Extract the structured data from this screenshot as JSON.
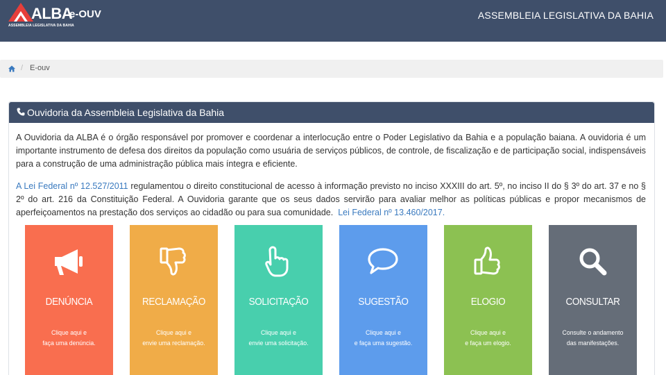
{
  "header": {
    "logo_name": "ALBA",
    "logo_sub": "e-OUV",
    "logo_tagline": "ASSEMBLEIA LEGISLATIVA DA BAHIA",
    "title": "ASSEMBLEIA LEGISLATIVA DA BAHIA",
    "logo_icon": "alba-logo-mark"
  },
  "breadcrumb": {
    "home_icon": "home-icon",
    "separator": "/",
    "current": "E-ouv"
  },
  "panel": {
    "icon": "phone-icon",
    "title": "Ouvidoria da Assembleia Legislativa da Bahia",
    "para1": "A Ouvidoria da ALBA é o órgão responsável por promover e coordenar a interlocução entre o Poder Legislativo da Bahia e a população baiana. A ouvidoria é um importante instrumento de defesa dos direitos da população como usuária de serviços públicos, de controle, de fiscalização e de participação social, indispensáveis para a construção de uma administração pública mais íntegra e eficiente.",
    "para2_link1": "A Lei Federal nº 12.527/2011",
    "para2_text": " regulamentou o direito constitucional de acesso à informação previsto no inciso XXXIII do art. 5º, no inciso II do § 3º do art. 37 e no § 2º do art. 216 da Constituição Federal. A Ouvidoria garante que os seus dados servirão para avaliar melhor as políticas públicas e propor mecanismos de aperfeiçoamentos na prestação dos serviços ao cidadão ou para sua comunidade.",
    "para2_link2": "Lei Federal nº 13.460/2017."
  },
  "tiles": [
    {
      "label": "DENÚNCIA",
      "line1": "Clique aqui e",
      "line2": "faça uma denúncia.",
      "color": "#f96e4f",
      "icon": "megaphone-icon"
    },
    {
      "label": "RECLAMAÇÃO",
      "line1": "Clique aqui e",
      "line2": "envie uma reclamação.",
      "color": "#f0ac48",
      "icon": "thumbs-down-icon"
    },
    {
      "label": "SOLICITAÇÃO",
      "line1": "Clique aqui e",
      "line2": "envie uma solicitação.",
      "color": "#48cfad",
      "icon": "hand-pointer-icon"
    },
    {
      "label": "SUGESTÃO",
      "line1": "Clique aqui e",
      "line2": "e faça uma sugestão.",
      "color": "#5d9cec",
      "icon": "speech-bubble-icon"
    },
    {
      "label": "ELOGIO",
      "line1": "Clique aqui e",
      "line2": "e faça um elogio.",
      "color": "#8cc152",
      "icon": "thumbs-up-icon"
    },
    {
      "label": "CONSULTAR",
      "line1": "Consulte o andamento",
      "line2": "das manifestações.",
      "color": "#656d78",
      "icon": "search-icon"
    }
  ]
}
